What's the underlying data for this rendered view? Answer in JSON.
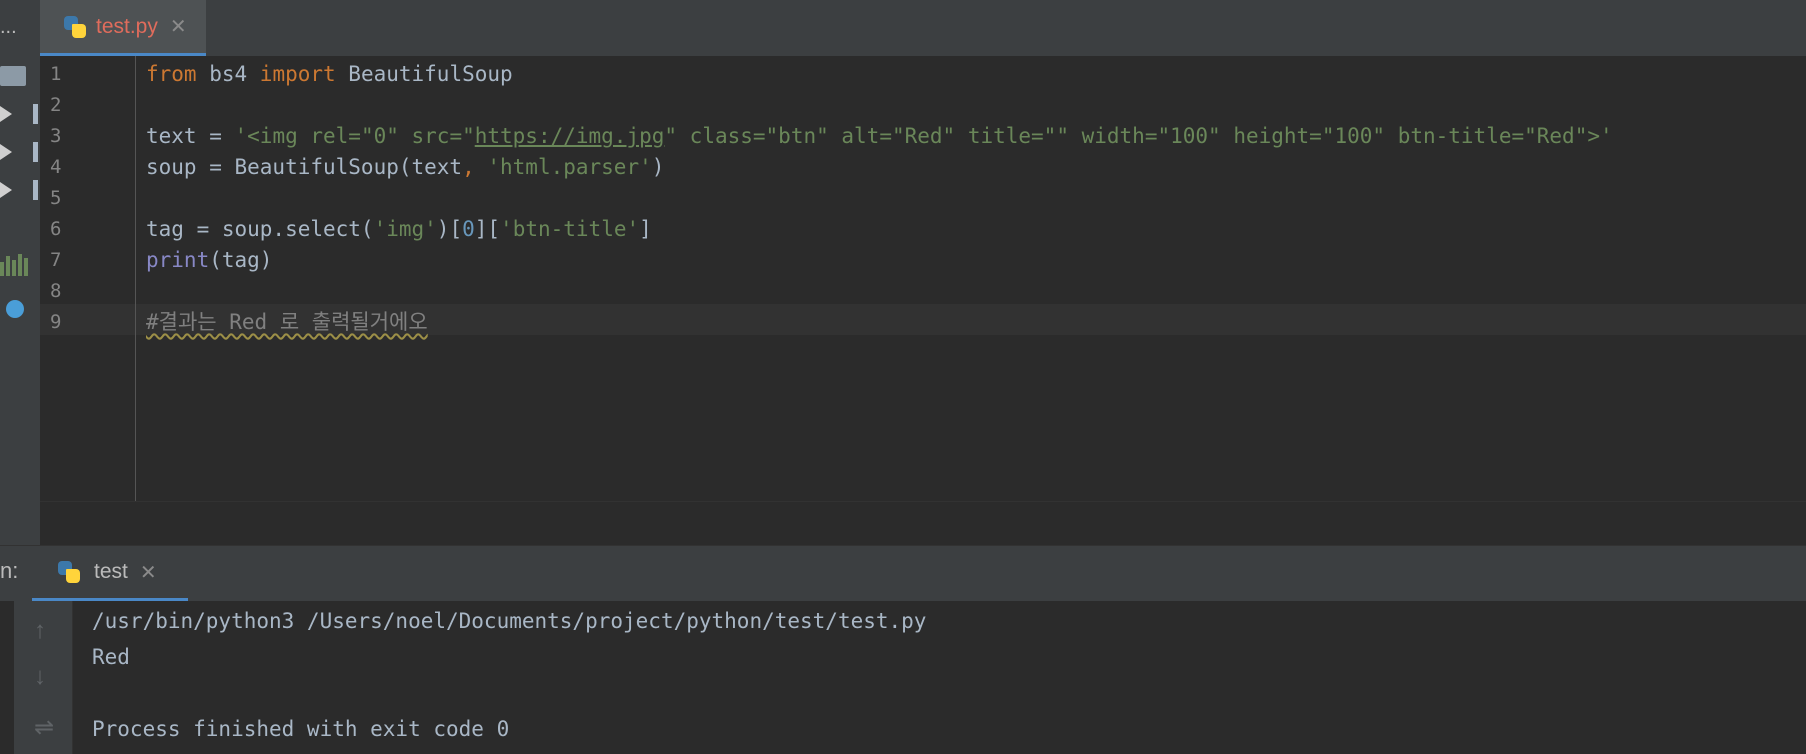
{
  "project_panel": {
    "header_text": "..."
  },
  "editor": {
    "tab": {
      "filename": "test.py",
      "close_symbol": "✕"
    },
    "current_line": 9,
    "lines": [
      {
        "num": "1",
        "parts": [
          {
            "t": "from",
            "c": "kw"
          },
          {
            "t": " bs4 "
          },
          {
            "t": "import",
            "c": "kw"
          },
          {
            "t": " BeautifulSoup"
          }
        ]
      },
      {
        "num": "2",
        "parts": []
      },
      {
        "num": "3",
        "parts": [
          {
            "t": "text = "
          },
          {
            "t": "'<img rel=\"0\" src=\"",
            "c": "str"
          },
          {
            "t": "https://img.jpg",
            "c": "str url"
          },
          {
            "t": "\" class=\"btn\" alt=\"Red\" title=\"\" width=\"100\" height=\"100\" btn-title=\"Red\">'",
            "c": "str"
          }
        ]
      },
      {
        "num": "4",
        "parts": [
          {
            "t": "soup = BeautifulSoup(text"
          },
          {
            "t": ", ",
            "c": "kw"
          },
          {
            "t": "'html.parser'",
            "c": "str"
          },
          {
            "t": ")"
          }
        ]
      },
      {
        "num": "5",
        "parts": []
      },
      {
        "num": "6",
        "parts": [
          {
            "t": "tag = soup.select("
          },
          {
            "t": "'img'",
            "c": "str"
          },
          {
            "t": ")["
          },
          {
            "t": "0",
            "c": "num"
          },
          {
            "t": "]["
          },
          {
            "t": "'btn-title'",
            "c": "str"
          },
          {
            "t": "]"
          }
        ]
      },
      {
        "num": "7",
        "parts": [
          {
            "t": "print",
            "c": "builtin"
          },
          {
            "t": "(tag)"
          }
        ]
      },
      {
        "num": "8",
        "parts": []
      },
      {
        "num": "9",
        "parts": [
          {
            "t": "#결과는 Red 로 출력될거에오",
            "c": "cmt"
          }
        ]
      }
    ]
  },
  "run_panel": {
    "label": "n:",
    "tab": {
      "name": "test",
      "close_symbol": "✕"
    },
    "toolbar": {
      "up_icon": "↑",
      "down_icon": "↓",
      "wrap_icon": "⇌"
    },
    "console": [
      "/usr/bin/python3 /Users/noel/Documents/project/python/test/test.py",
      "Red",
      "",
      "Process finished with exit code 0"
    ]
  },
  "colors": {
    "background": "#2b2b2b",
    "panel": "#3c3f41",
    "keyword": "#cc7832",
    "string": "#6a8759",
    "number": "#6897bb",
    "builtin": "#8888c6",
    "comment": "#808080",
    "text": "#a9b7c6",
    "accent": "#4a88c7"
  }
}
